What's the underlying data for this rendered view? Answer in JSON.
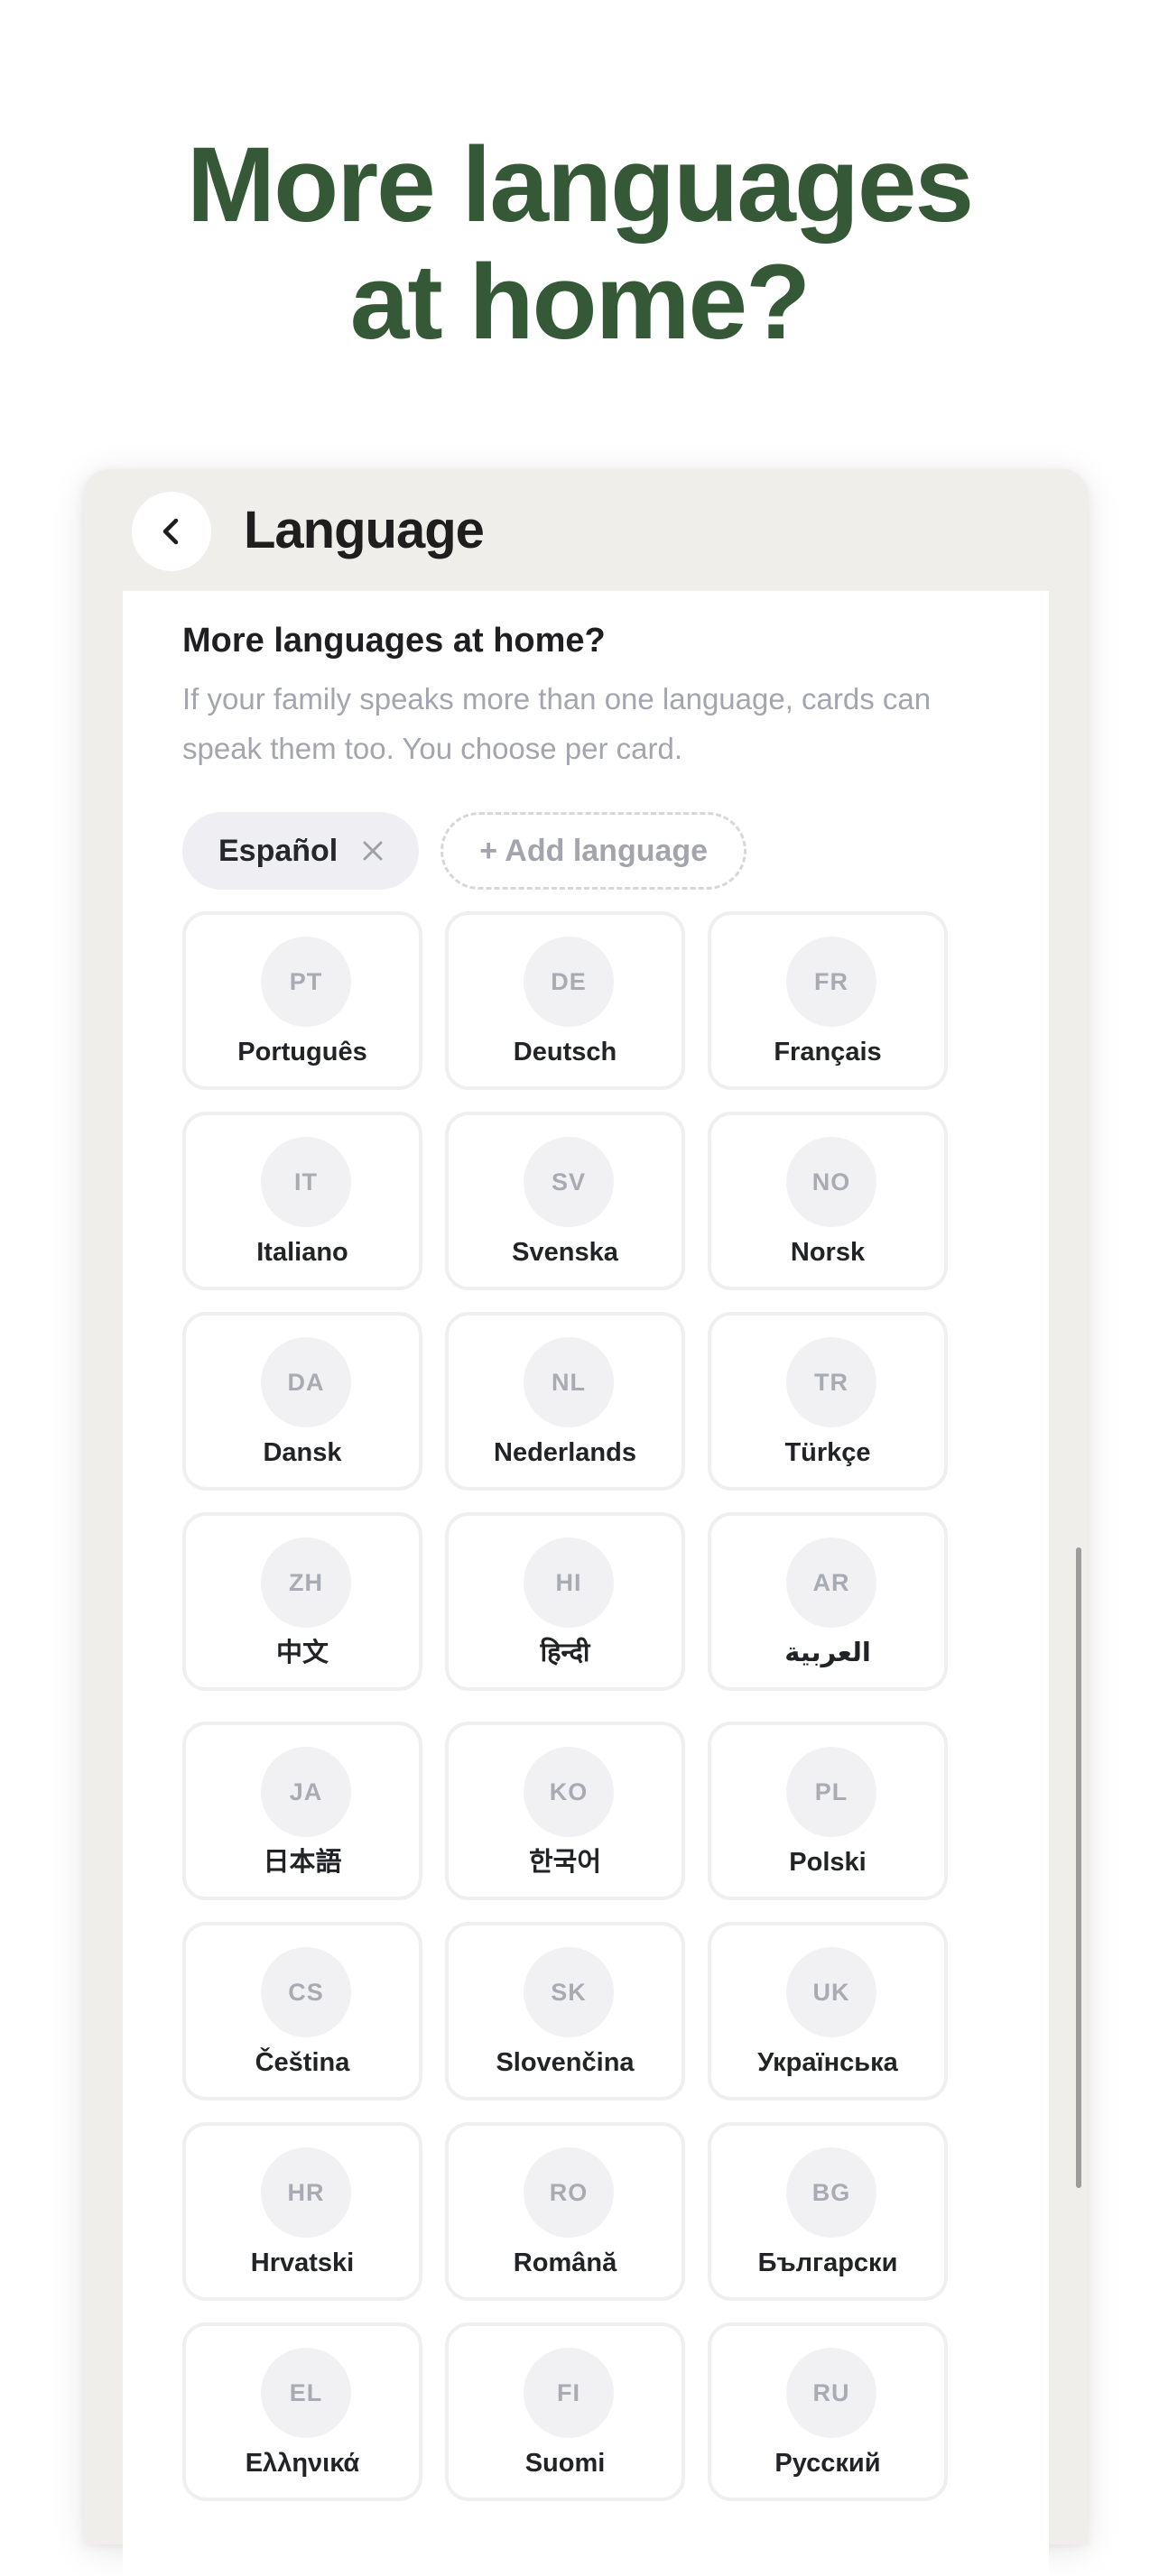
{
  "hero": {
    "line1": "More languages",
    "line2": "at home?"
  },
  "nav": {
    "title": "Language",
    "back_icon": "chevron-left-icon"
  },
  "section": {
    "title": "More languages at home?",
    "description": "If your family speaks more than one language, cards can speak them too. You choose per card."
  },
  "chips": {
    "selected_label": "Español",
    "remove_icon": "close-icon",
    "add_label": "+ Add language"
  },
  "languages": [
    {
      "code": "PT",
      "name": "Português"
    },
    {
      "code": "DE",
      "name": "Deutsch"
    },
    {
      "code": "FR",
      "name": "Français"
    },
    {
      "code": "IT",
      "name": "Italiano"
    },
    {
      "code": "SV",
      "name": "Svenska"
    },
    {
      "code": "NO",
      "name": "Norsk"
    },
    {
      "code": "DA",
      "name": "Dansk"
    },
    {
      "code": "NL",
      "name": "Nederlands"
    },
    {
      "code": "TR",
      "name": "Türkçe"
    },
    {
      "code": "ZH",
      "name": "中文"
    },
    {
      "code": "HI",
      "name": "हिन्दी"
    },
    {
      "code": "AR",
      "name": "العربية"
    },
    {
      "code": "JA",
      "name": "日本語"
    },
    {
      "code": "KO",
      "name": "한국어"
    },
    {
      "code": "PL",
      "name": "Polski"
    },
    {
      "code": "CS",
      "name": "Čeština"
    },
    {
      "code": "SK",
      "name": "Slovenčina"
    },
    {
      "code": "UK",
      "name": "Українська"
    },
    {
      "code": "HR",
      "name": "Hrvatski"
    },
    {
      "code": "RO",
      "name": "Română"
    },
    {
      "code": "BG",
      "name": "Български"
    },
    {
      "code": "EL",
      "name": "Ελληνικά"
    },
    {
      "code": "FI",
      "name": "Suomi"
    },
    {
      "code": "RU",
      "name": "Русский"
    }
  ],
  "colors": {
    "hero_green": "#355936",
    "background": "#ffffff",
    "device_frame": "#efeeeb",
    "muted_text": "#a3a6ae"
  }
}
